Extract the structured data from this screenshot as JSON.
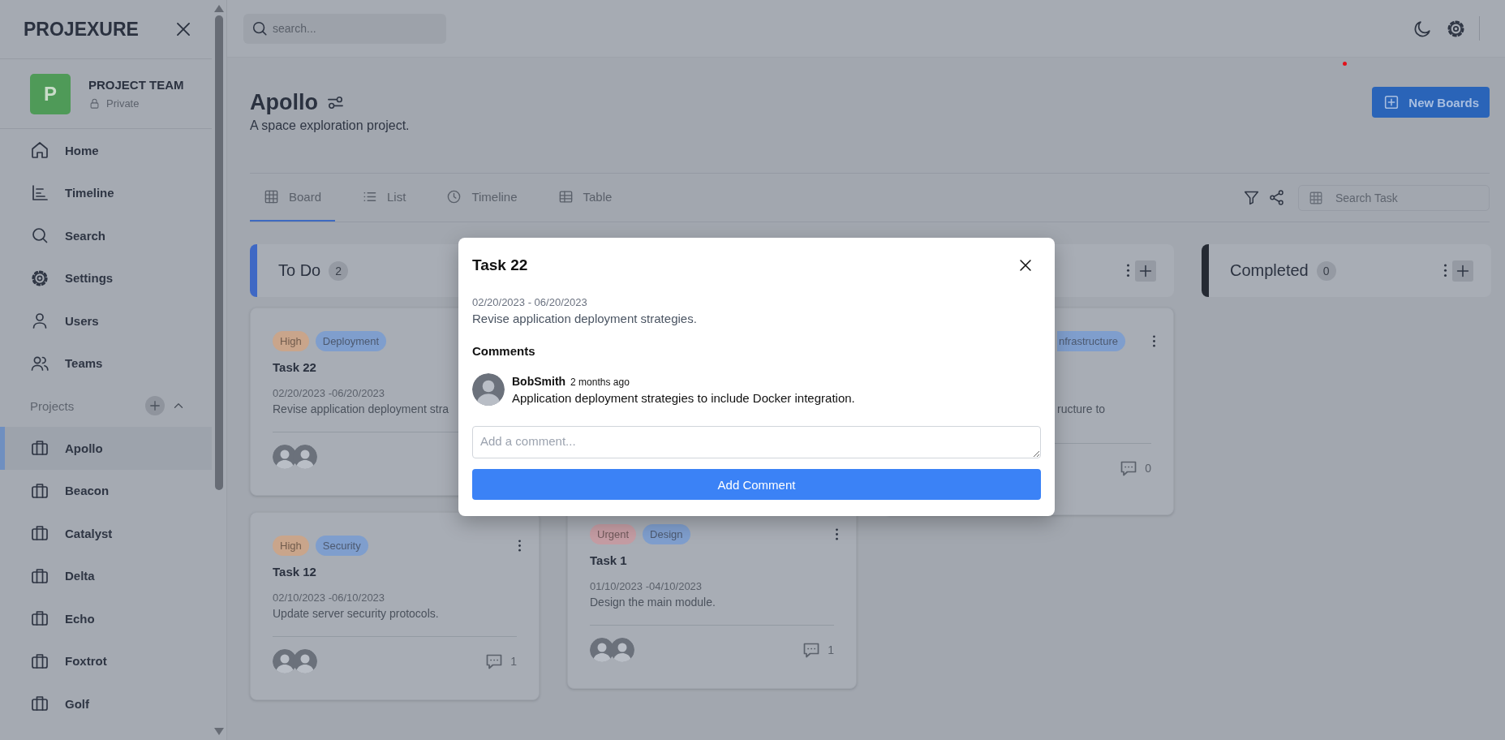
{
  "sidebar": {
    "brand": "PROJEXURE",
    "team": {
      "initial": "P",
      "name": "PROJECT TEAM",
      "visibility": "Private"
    },
    "nav": [
      {
        "label": "Home",
        "kind": "home",
        "selected": false
      },
      {
        "label": "Timeline",
        "kind": "timeline",
        "selected": false
      },
      {
        "label": "Search",
        "kind": "search",
        "selected": false
      },
      {
        "label": "Settings",
        "kind": "settings",
        "selected": false
      },
      {
        "label": "Users",
        "kind": "users",
        "selected": false
      },
      {
        "label": "Teams",
        "kind": "teams",
        "selected": false
      }
    ],
    "projects_label": "Projects",
    "projects": [
      {
        "label": "Apollo",
        "selected": true
      },
      {
        "label": "Beacon",
        "selected": false
      },
      {
        "label": "Catalyst",
        "selected": false
      },
      {
        "label": "Delta",
        "selected": false
      },
      {
        "label": "Echo",
        "selected": false
      },
      {
        "label": "Foxtrot",
        "selected": false
      },
      {
        "label": "Golf",
        "selected": false
      }
    ]
  },
  "topbar": {
    "search": {
      "placeholder": "search..."
    }
  },
  "project": {
    "title": "Apollo",
    "description": "A space exploration project.",
    "new_button": "New Boards"
  },
  "tabs": [
    {
      "label": "Board",
      "kind": "board",
      "selected": true
    },
    {
      "label": "List",
      "kind": "list",
      "selected": false
    },
    {
      "label": "Timeline",
      "kind": "timeline",
      "selected": false
    },
    {
      "label": "Table",
      "kind": "table",
      "selected": false
    }
  ],
  "task_search": {
    "placeholder": "Search Task"
  },
  "columns": [
    {
      "title": "To Do",
      "count": "2",
      "color": "#3f68c4",
      "menu": false,
      "cards": [
        {
          "tags": [
            {
              "label": "High",
              "color": "#c9a58b"
            },
            {
              "label": "Deployment",
              "color": "#7f9ecd"
            }
          ],
          "title": "Task 22",
          "dates": "02/20/2023 -06/20/2023",
          "description": "Revise application deployment stra",
          "menu": false
        },
        {
          "tags": [
            {
              "label": "High",
              "color": "#c9a58b"
            },
            {
              "label": "Security",
              "color": "#7f9ecd"
            }
          ],
          "title": "Task 12",
          "dates": "02/10/2023 -06/10/2023",
          "description": "Update server security protocols.",
          "menu": true,
          "comments": "1"
        }
      ]
    },
    {
      "cards": [
        {
          "tags": [
            {
              "label": "Urgent",
              "color": "#c49ca3"
            },
            {
              "label": "Design",
              "color": "#7f9ecd"
            }
          ],
          "title": "Task 1",
          "dates": "01/10/2023 -04/10/2023",
          "description": "Design the main module.",
          "menu": true,
          "comments": "1"
        }
      ]
    },
    {
      "menu": true,
      "cards": [
        {
          "tags": [
            {
              "label": "nfrastructure",
              "color": "#7f9ecd"
            }
          ],
          "description": "ructure to",
          "menu": true,
          "comments": "0"
        }
      ]
    },
    {
      "title": "Completed",
      "count": "0",
      "color": "#252a33",
      "menu": true
    }
  ],
  "modal": {
    "title": "Task 22",
    "dates": "02/20/2023 - 06/20/2023",
    "description": "Revise application deployment strategies.",
    "comments_heading": "Comments",
    "comments": [
      {
        "author": "BobSmith",
        "time": "2 months ago",
        "text": "Application deployment strategies to include Docker integration."
      }
    ],
    "input": {
      "placeholder": "Add a comment..."
    },
    "submit": "Add Comment"
  }
}
